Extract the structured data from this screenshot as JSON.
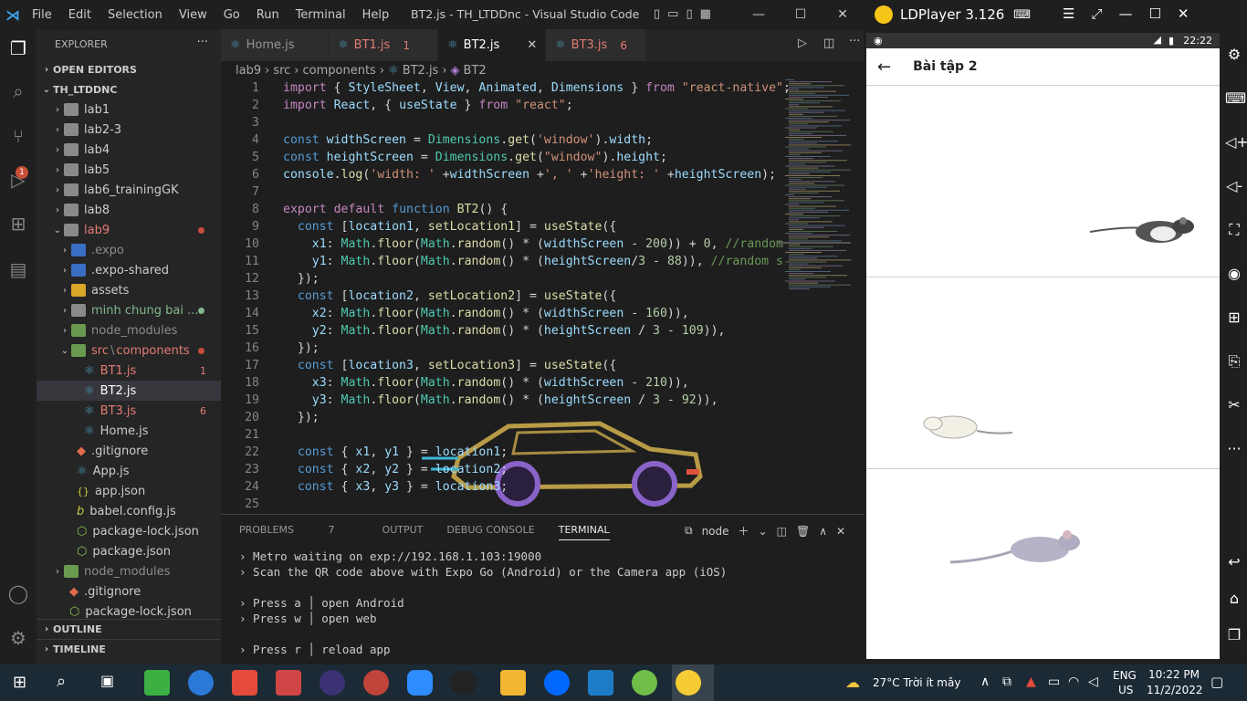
{
  "vscode": {
    "title": "BT2.js - TH_LTDDnc - Visual Studio Code",
    "menu": [
      "File",
      "Edit",
      "Selection",
      "View",
      "Go",
      "Run",
      "Terminal",
      "Help"
    ],
    "explorer": {
      "header": "EXPLORER",
      "open_editors": "OPEN EDITORS",
      "workspace": "TH_LTDDNC",
      "items": [
        {
          "label": "lab1"
        },
        {
          "label": "lab2-3"
        },
        {
          "label": "lab4"
        },
        {
          "label": "lab5"
        },
        {
          "label": "lab6_trainingGK"
        },
        {
          "label": "lab8"
        },
        {
          "label": "lab9"
        },
        {
          "label": ".expo"
        },
        {
          "label": ".expo-shared"
        },
        {
          "label": "assets"
        },
        {
          "label": "minh chung bai ..."
        },
        {
          "label": "node_modules"
        },
        {
          "label": "src",
          "sep": "\\",
          "label2": "components"
        },
        {
          "label": "BT1.js",
          "badge": "1"
        },
        {
          "label": "BT2.js"
        },
        {
          "label": "BT3.js",
          "badge": "6"
        },
        {
          "label": "Home.js"
        },
        {
          "label": ".gitignore"
        },
        {
          "label": "App.js"
        },
        {
          "label": "app.json"
        },
        {
          "label": "babel.config.js"
        },
        {
          "label": "package-lock.json"
        },
        {
          "label": "package.json"
        },
        {
          "label": "node_modules"
        },
        {
          "label": ".gitignore"
        },
        {
          "label": "package-lock.json"
        }
      ],
      "outline": "OUTLINE",
      "timeline": "TIMELINE"
    },
    "tabs": [
      {
        "label": "Home.js",
        "count": ""
      },
      {
        "label": "BT1.js",
        "count": "1"
      },
      {
        "label": "BT2.js",
        "count": ""
      },
      {
        "label": "BT3.js",
        "count": "6"
      }
    ],
    "breadcrumb": [
      "lab9",
      "src",
      "components",
      "BT2.js",
      "BT2"
    ],
    "line_numbers": [
      "1",
      "2",
      "3",
      "4",
      "5",
      "6",
      "7",
      "8",
      "9",
      "10",
      "11",
      "12",
      "13",
      "14",
      "15",
      "16",
      "17",
      "18",
      "19",
      "20",
      "21",
      "22",
      "23",
      "24",
      "25"
    ],
    "panel": {
      "tabs": [
        "PROBLEMS",
        "7",
        "OUTPUT",
        "DEBUG CONSOLE",
        "TERMINAL"
      ],
      "terminal_name": "node",
      "lines": [
        "› Metro waiting on exp://192.168.1.103:19000",
        "› Scan the QR code above with Expo Go (Android) or the Camera app (iOS)",
        "",
        "› Press a │ open Android",
        "› Press w │ open web",
        "",
        "› Press r │ reload app"
      ]
    }
  },
  "ldplayer": {
    "title": "LDPlayer 3.126",
    "status_time": "22:22",
    "app_title": "Bài tập 2"
  },
  "taskbar": {
    "weather": "27°C  Trời ít mây",
    "lang1": "ENG",
    "lang2": "US",
    "time": "10:22 PM",
    "date": "11/2/2022"
  }
}
